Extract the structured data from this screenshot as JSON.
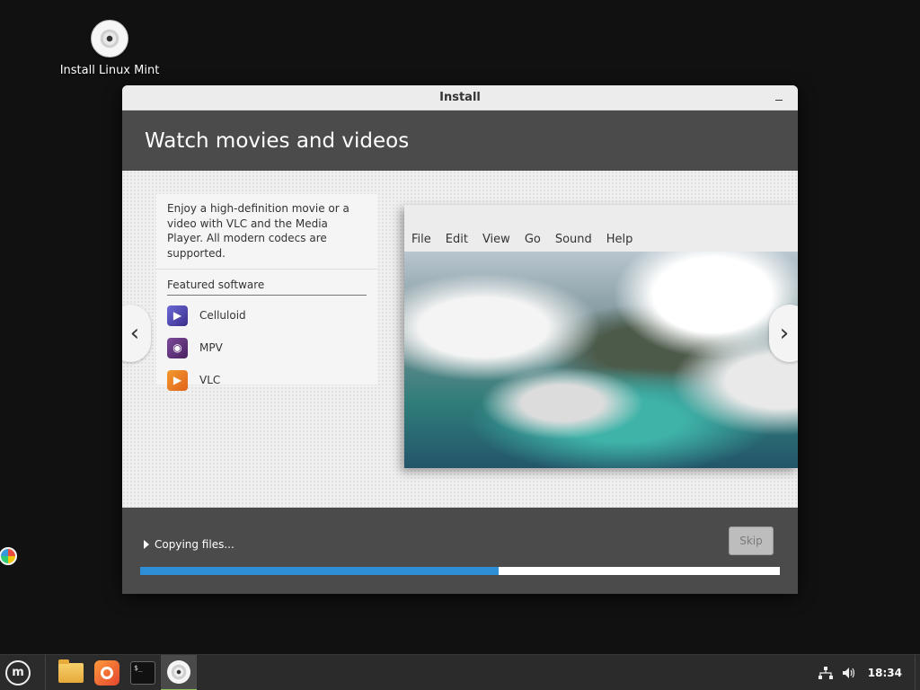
{
  "desktop": {
    "icon_label": "Install Linux Mint"
  },
  "window": {
    "title": "Install",
    "banner_title": "Watch movies and videos",
    "description": "Enjoy a high-definition movie or a video with VLC and the Media Player. All modern codecs are supported.",
    "featured_title": "Featured software",
    "apps": [
      {
        "name": "Celluloid"
      },
      {
        "name": "MPV"
      },
      {
        "name": "VLC"
      }
    ],
    "preview_menu": [
      "File",
      "Edit",
      "View",
      "Go",
      "Sound",
      "Help"
    ],
    "nav_prev": "‹",
    "nav_next": "›",
    "status_text": "Copying files...",
    "skip_label": "Skip",
    "progress": 0.56
  },
  "taskbar": {
    "clock": "18:34",
    "terminal_prompt": "$_"
  },
  "colors": {
    "progress": "#2f8fd6",
    "banner": "#4b4b4b"
  }
}
